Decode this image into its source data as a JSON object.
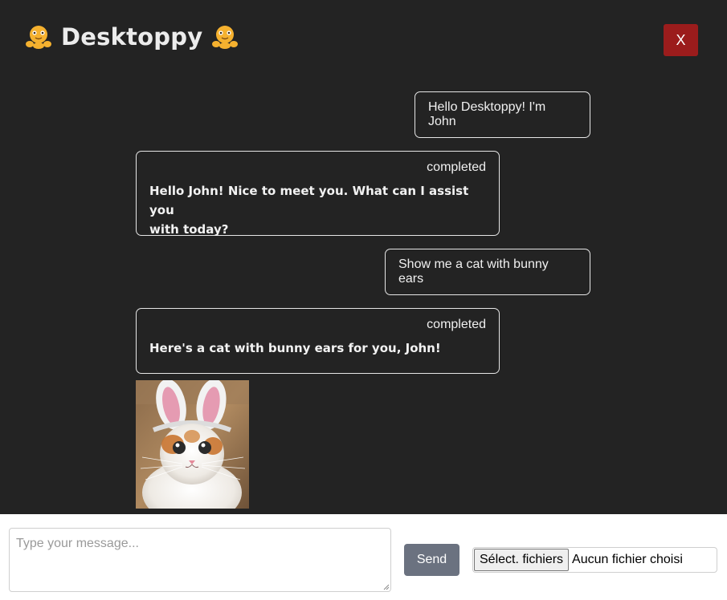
{
  "header": {
    "title": "Desktoppy",
    "close_label": "X",
    "icons": [
      "hugging-octopus-emoji-icon",
      "hugging-octopus-emoji-icon"
    ]
  },
  "messages": [
    {
      "role": "user",
      "text": "Hello Desktoppy! I'm John"
    },
    {
      "role": "assistant",
      "status": "completed",
      "text_lines": [
        "Hello John! Nice to meet you. What can I assist you",
        "with today?"
      ]
    },
    {
      "role": "user",
      "text": "Show me a cat with bunny ears"
    },
    {
      "role": "assistant",
      "status": "completed",
      "text_lines": [
        "Here's a cat with bunny ears for you, John!"
      ]
    }
  ],
  "image": {
    "subject": "cat-with-bunny-ears-image"
  },
  "composer": {
    "placeholder": "Type your message...",
    "send_label": "Send",
    "file_button_label": "Sélect. fichiers",
    "file_status": "Aucun fichier choisi"
  },
  "colors": {
    "background": "#232323",
    "close_button": "#9b1c1c",
    "send_button": "#6b7280",
    "bubble_border": "#e6e6e6",
    "footer": "#ffffff"
  }
}
